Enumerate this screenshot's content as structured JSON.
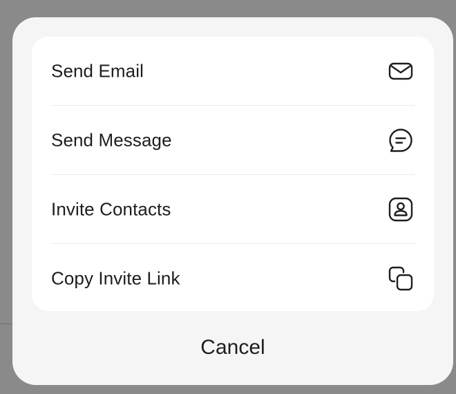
{
  "action_sheet": {
    "items": [
      {
        "label": "Send Email",
        "icon": "mail-icon"
      },
      {
        "label": "Send Message",
        "icon": "message-icon"
      },
      {
        "label": "Invite Contacts",
        "icon": "contact-icon"
      },
      {
        "label": "Copy Invite Link",
        "icon": "copy-icon"
      }
    ],
    "cancel_label": "Cancel"
  },
  "colors": {
    "backdrop": "#8a8a8a",
    "sheet": "#f4f5f4",
    "card": "#ffffff",
    "text": "#1d1d1f",
    "divider": "#ececec"
  }
}
